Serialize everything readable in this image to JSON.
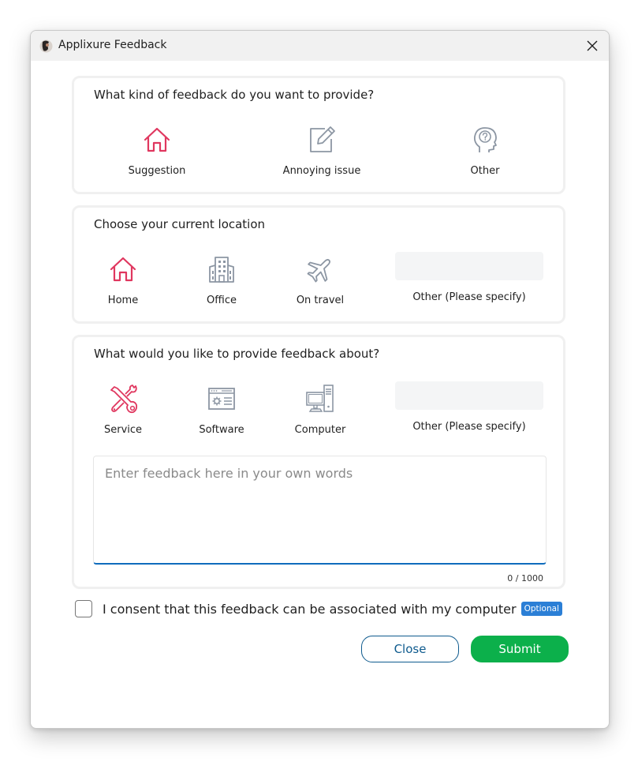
{
  "window": {
    "title": "Applixure Feedback"
  },
  "colors": {
    "accent_pink": "#e0375f",
    "icon_gray": "#8c96a3",
    "submit_green": "#0cb04b",
    "close_border": "#0f5b8e",
    "input_underline": "#0f6cbd",
    "badge_blue": "#2b7fd6"
  },
  "feedback_type": {
    "title": "What kind of feedback do you want to provide?",
    "options": [
      {
        "label": "Suggestion",
        "icon": "house-icon",
        "selected": true
      },
      {
        "label": "Annoying issue",
        "icon": "edit-note-icon",
        "selected": false
      },
      {
        "label": "Other",
        "icon": "head-question-icon",
        "selected": false
      }
    ]
  },
  "location": {
    "title": "Choose your current location",
    "options": [
      {
        "label": "Home",
        "icon": "house-icon",
        "selected": true
      },
      {
        "label": "Office",
        "icon": "office-building-icon",
        "selected": false
      },
      {
        "label": "On travel",
        "icon": "airplane-icon",
        "selected": false
      },
      {
        "label": "Other (Please specify)",
        "icon": "",
        "selected": false
      }
    ],
    "specify_value": ""
  },
  "topic": {
    "title": "What would you like to provide feedback about?",
    "options": [
      {
        "label": "Service",
        "icon": "tools-icon",
        "selected": true
      },
      {
        "label": "Software",
        "icon": "app-window-icon",
        "selected": false
      },
      {
        "label": "Computer",
        "icon": "desktop-computer-icon",
        "selected": false
      },
      {
        "label": "Other (Please specify)",
        "icon": "",
        "selected": false
      }
    ],
    "specify_value": "",
    "feedback_placeholder": "Enter feedback here in your own words",
    "feedback_value": "",
    "counter": "0 / 1000"
  },
  "consent": {
    "label": "I consent that this feedback can be associated with my computer",
    "badge": "Optional",
    "checked": false
  },
  "buttons": {
    "close_label": "Close",
    "submit_label": "Submit"
  }
}
